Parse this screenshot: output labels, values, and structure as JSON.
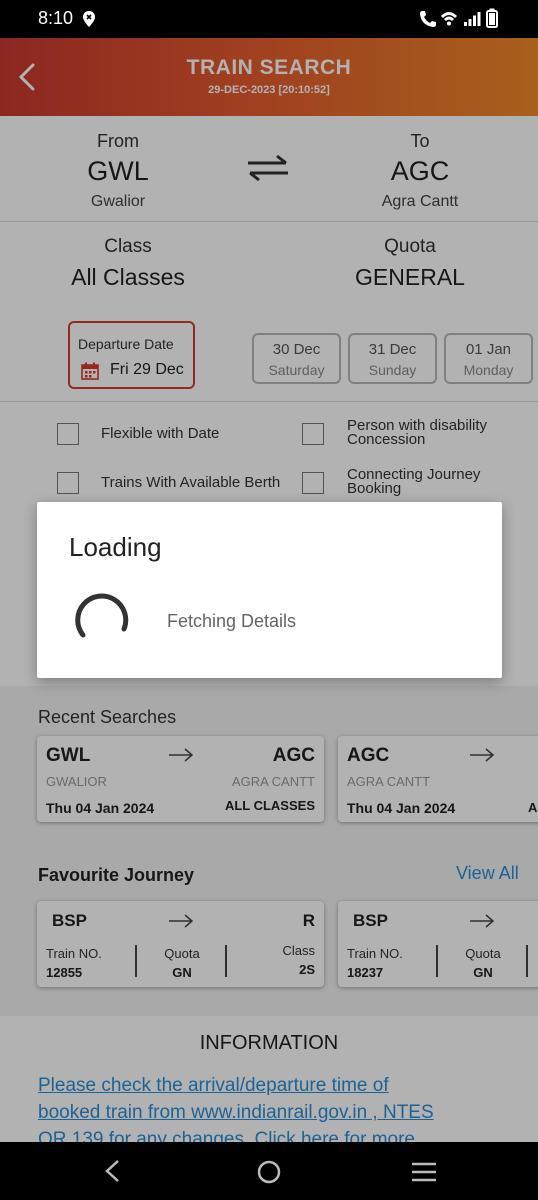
{
  "status_bar": {
    "time": "8:10"
  },
  "header": {
    "title": "TRAIN SEARCH",
    "subtitle": "29-DEC-2023 [20:10:52]"
  },
  "route": {
    "from_label": "From",
    "from_code": "GWL",
    "from_city": "Gwalior",
    "to_label": "To",
    "to_code": "AGC",
    "to_city": "Agra Cantt"
  },
  "class_quota": {
    "class_label": "Class",
    "class_value": "All Classes",
    "quota_label": "Quota",
    "quota_value": "GENERAL"
  },
  "departure": {
    "label": "Departure Date",
    "value": "Fri 29 Dec",
    "quick_dates": [
      {
        "date": "30 Dec",
        "day": "Saturday"
      },
      {
        "date": "31 Dec",
        "day": "Sunday"
      },
      {
        "date": "01 Jan",
        "day": "Monday"
      }
    ]
  },
  "options": {
    "flexible": "Flexible with Date",
    "disability_1": "Person with disability",
    "disability_2": "Concession",
    "available_berth": "Trains With Available Berth",
    "connecting_1": "Connecting Journey",
    "connecting_2": "Booking"
  },
  "recent": {
    "title": "Recent Searches",
    "cards": [
      {
        "from": "GWL",
        "to": "AGC",
        "from_city": "GWALIOR",
        "to_city": "AGRA CANTT",
        "date": "Thu 04 Jan 2024",
        "class": "ALL CLASSES"
      },
      {
        "from": "AGC",
        "to": "",
        "from_city": "AGRA CANTT",
        "to_city": "",
        "date": "Thu 04 Jan 2024",
        "class": "A"
      }
    ]
  },
  "favourite": {
    "title": "Favourite Journey",
    "view_all": "View All",
    "cards": [
      {
        "from": "BSP",
        "to": "R",
        "train_label": "Train NO.",
        "train_no": "12855",
        "quota_label": "Quota",
        "quota": "GN",
        "class_label": "Class",
        "class": "2S"
      },
      {
        "from": "BSP",
        "to": "",
        "train_label": "Train NO.",
        "train_no": "18237",
        "quota_label": "Quota",
        "quota": "GN",
        "class_label": "",
        "class": ""
      }
    ]
  },
  "information": {
    "title": "INFORMATION",
    "lines": [
      "Please check the arrival/departure time of",
      "booked train from www.indianrail.gov.in , NTES",
      "OR 139 for any changes. Click here for more"
    ],
    "link_color": "#2a8fd6"
  },
  "dialog": {
    "title": "Loading",
    "message": "Fetching Details"
  },
  "colors": {
    "header_start": "#c8392e",
    "header_end": "#f08a2a",
    "selected_border": "#d63a2e",
    "link": "#2a8fd6"
  }
}
